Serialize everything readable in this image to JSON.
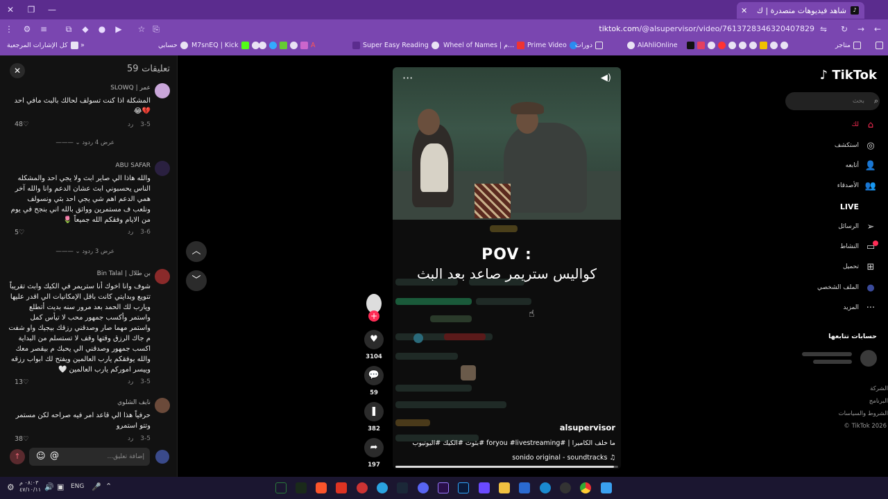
{
  "browser": {
    "tab_title": "شاهد فيديوهات متصدرة | ك",
    "url_host": "tiktok.com",
    "url_path": "/@alsupervisor/video/7613728346320407829",
    "bookmarks": [
      "كل الإشارات المرجعية",
      "حسابي",
      "M7snEQ | Kick",
      "Super Easy Reading",
      "Wheel of Names | م...",
      "Prime Video",
      "دورات",
      "AlAhliOnline",
      "متاجر"
    ],
    "colors": {
      "chrome": "#7a46b0",
      "titlebar": "#5b2c8e"
    }
  },
  "comments": {
    "title": "تعليقات",
    "count": "59",
    "input_placeholder": "إضافة تعليق...",
    "items": [
      {
        "user": "عمر | SLOWQ",
        "text": "المشكلة اذا كنت تسولف لحالك بالبث مافي احد 💔😂",
        "date": "3-5",
        "reply": "رد",
        "likes": "48",
        "replies": "عرض 4 ردود"
      },
      {
        "user": "ABU SAFAR",
        "text": "والله هاذا الي صاير ابث ولا يجي احد والمشكله الناس يحسبوني ابث عشان الدعم وانا والله آخر همي الدعم اهم شي يجي احد بثي ونسولف ونلعب ف مستمرين وواثق بالله اني بنجح في يوم من الايام وفقكم الله جميعاً 🌷",
        "date": "3-6",
        "reply": "رد",
        "likes": "5",
        "replies": "عرض 3 ردود"
      },
      {
        "user": "بن طلال | Bin Talal",
        "text": "شوف وانا اخوك أنا ستريمر في الكيك وابث تقريباً تتويع وبدايتي كانت باقل الإمكانيات الي اقدر عليها ويارب لك الحمد بعد مرور سنه بديت أتطلع واستمر وأكسب جمهور محب لا تيأس كمل واستمر مهما صار وصدقني رزقك بيجيك واو شفت م جاك الرزق وقتها وقف لا تستسلم من البداية اكسب جمهور وصدقني الي يحبك م بيقصر معك والله يوفقكم يارب العالمين ويفتح لك ابواب رزقه وييسر اموركم يارب العالمين 🤍",
        "date": "3-5",
        "reply": "رد",
        "likes": "13"
      },
      {
        "user": "نايف الشلوي",
        "text": "حرفياً هذا الي قاعد امر فيه صراحه لكن مستمر وتتو استمرو",
        "date": "3-5",
        "reply": "رد",
        "likes": "38"
      }
    ]
  },
  "video": {
    "pov": "POV :",
    "caption_overlay": "كواليس ستريمر صاعد بعد البث",
    "author": "alsupervisor",
    "description": "ما خلف الكاميرا | #foryou #livestreaming #بثوث #الكيك #اليوتيوب",
    "music": "sonido original - soundtracks",
    "progress": 0.98
  },
  "actions": {
    "likes": "3104",
    "comments": "59",
    "saves": "382",
    "shares": "197"
  },
  "sidebar": {
    "logo": "TikTok",
    "search_placeholder": "بحث",
    "items": [
      "لك",
      "استكشف",
      "أتابعه",
      "الأصدقاء",
      "LIVE",
      "الرسائل",
      "النشاط",
      "تحميل",
      "الملف الشخصي",
      "المزيد"
    ],
    "following_title": "حسابات تتابعها",
    "footer": [
      "الشركة",
      "البرنامج",
      "الشروط والسياسات",
      "© TikTok 2026"
    ]
  },
  "taskbar": {
    "lang": "ENG",
    "time": "٠٨:٠٣ م",
    "date": "٤٧/١٠/١١"
  }
}
